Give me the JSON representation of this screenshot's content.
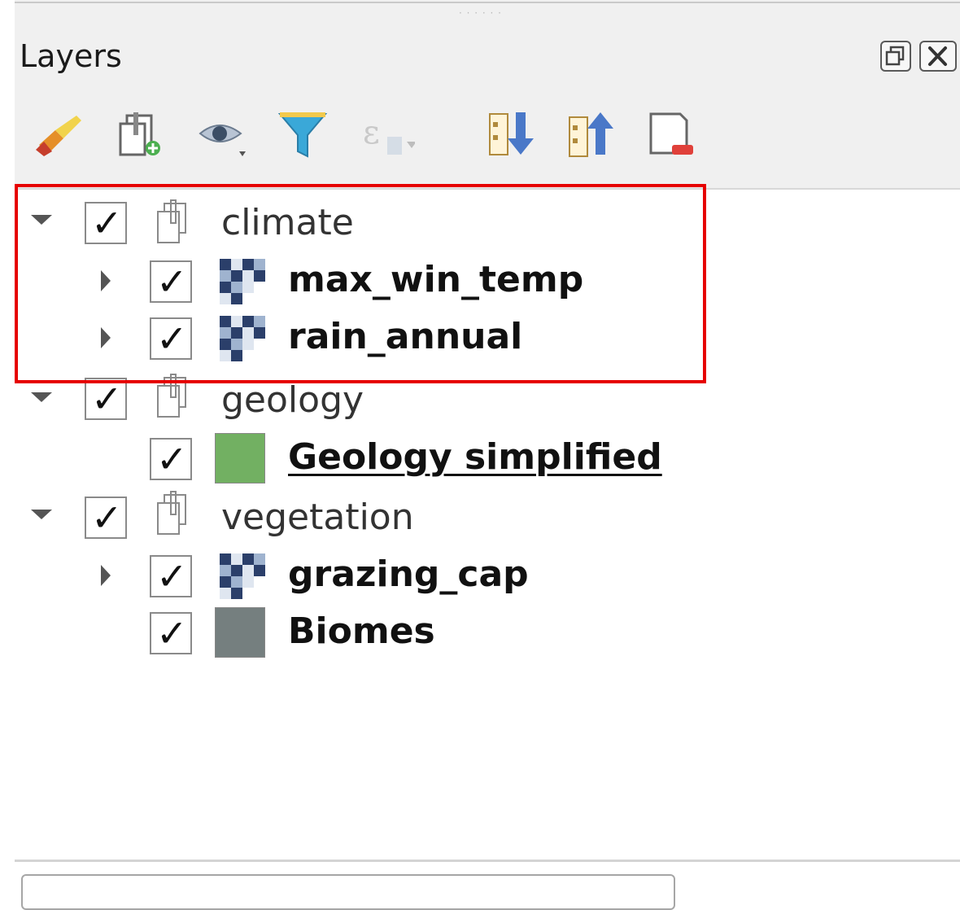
{
  "panel": {
    "title": "Layers",
    "window_buttons": [
      {
        "icon": "float-icon"
      },
      {
        "icon": "close-icon"
      }
    ]
  },
  "toolbar": {
    "tools": [
      {
        "icon": "style-brush-icon"
      },
      {
        "icon": "add-group-icon"
      },
      {
        "icon": "visibility-eye-icon"
      },
      {
        "icon": "filter-icon"
      },
      {
        "icon": "expression-filter-icon"
      },
      {
        "icon": "expand-all-icon"
      },
      {
        "icon": "collapse-all-icon"
      },
      {
        "icon": "remove-layer-icon"
      }
    ]
  },
  "tree": {
    "groups": [
      {
        "label": "climate",
        "checked": true,
        "expanded": true,
        "children": [
          {
            "label": "max_win_temp",
            "type": "raster",
            "checked": true,
            "expandable": true
          },
          {
            "label": "rain_annual",
            "type": "raster",
            "checked": true,
            "expandable": true
          }
        ]
      },
      {
        "label": "geology",
        "checked": true,
        "expanded": true,
        "children": [
          {
            "label": "Geology simplified",
            "type": "vector",
            "swatch_color": "#72b062",
            "checked": true,
            "expandable": false
          }
        ]
      },
      {
        "label": "vegetation",
        "checked": true,
        "expanded": true,
        "children": [
          {
            "label": "grazing_cap",
            "type": "raster",
            "checked": true,
            "expandable": true
          },
          {
            "label": "Biomes",
            "type": "vector",
            "swatch_color": "#757f7f",
            "checked": true,
            "expandable": false
          }
        ]
      }
    ]
  },
  "colors": {
    "highlight_border": "#e60000",
    "panel_header_bg": "#f0f0f0"
  }
}
